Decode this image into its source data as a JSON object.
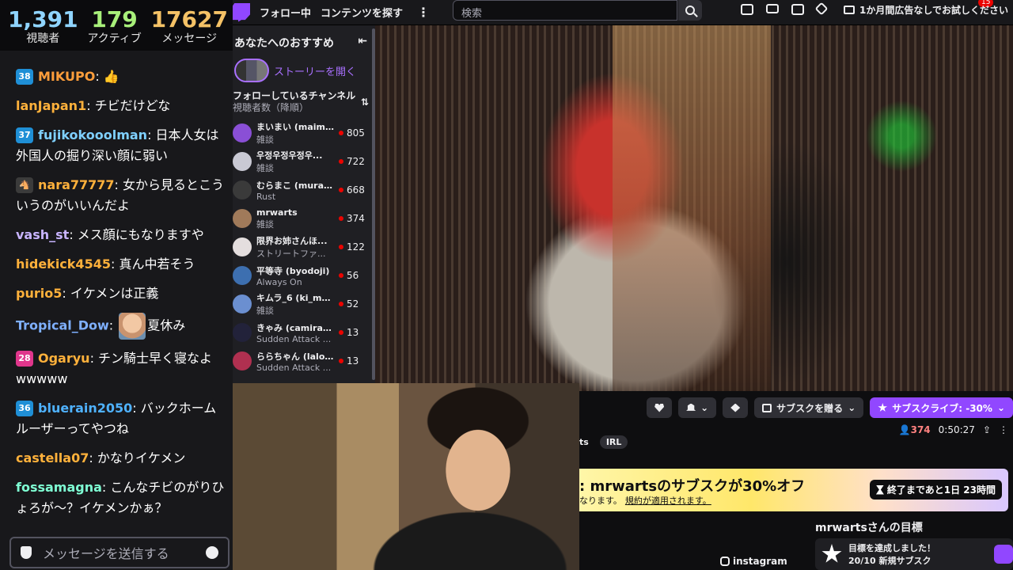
{
  "stats": [
    {
      "value": "1,391",
      "label": "視聴者",
      "color": "#8fd4ff"
    },
    {
      "value": "179",
      "label": "アクティブ",
      "color": "#a8f07a"
    },
    {
      "value": "17627",
      "label": "メッセージ",
      "color": "#f5c266"
    }
  ],
  "chat": [
    {
      "badge": "38",
      "badge_color": "#1f8fd6",
      "user": "MIKUPO",
      "color": "#ff9e3b",
      "text": ": 👍"
    },
    {
      "badge": "",
      "badge_color": "",
      "user": "lanJapan1",
      "color": "#ffb13b",
      "text": ": チビだけどな"
    },
    {
      "badge": "37",
      "badge_color": "#1f8fd6",
      "user": "fujikokooolman",
      "color": "#7fd0ff",
      "text": ": 日本人女は外国人の掘り深い顔に弱い"
    },
    {
      "badge": "🐴",
      "badge_color": "#3b3b3b",
      "user": "nara77777",
      "color": "#ffb13b",
      "text": ": 女から見るとこういうのがいいんだよ"
    },
    {
      "badge": "",
      "badge_color": "",
      "user": "vash_st",
      "color": "#c8b4ff",
      "text": ": メス顔にもなりますや"
    },
    {
      "badge": "",
      "badge_color": "",
      "user": "hidekick4545",
      "color": "#ffb13b",
      "text": ": 真ん中若そう"
    },
    {
      "badge": "",
      "badge_color": "",
      "user": "purio5",
      "color": "#ffb13b",
      "text": ": イケメンは正義"
    },
    {
      "badge": "",
      "badge_color": "",
      "user": "Tropical_Dow",
      "color": "#7fb0ff",
      "text": ": ",
      "emote": true,
      "text2": "夏休み"
    },
    {
      "badge": "28",
      "badge_color": "#e0368c",
      "user": "Ogaryu",
      "color": "#ffb13b",
      "text": ": チン騎士早く寝なよwwwww"
    },
    {
      "badge": "36",
      "badge_color": "#1f8fd6",
      "user": "bluerain2050",
      "color": "#4fb2ff",
      "text": ": バックホームルーザーってやつね"
    },
    {
      "badge": "",
      "badge_color": "",
      "user": "castella07",
      "color": "#ffb13b",
      "text": ": かなりイケメン"
    },
    {
      "badge": "",
      "badge_color": "",
      "user": "fossamagna",
      "color": "#7fffd4",
      "text": ": こんなチビのがりひょろが〜？イケメンかぁ？"
    }
  ],
  "chat_input": {
    "placeholder": "メッセージを送信する"
  },
  "topnav": {
    "following": "フォロー中",
    "browse": "コンテンツを探す",
    "more": "⋮",
    "search_placeholder": "検索",
    "notifications": "15",
    "trial": "1か月間広告なしでお試しください"
  },
  "sidenav": {
    "title": "あなたへのおすすめ",
    "collapse": "⇤",
    "story": "ストーリーを開く",
    "followed_title": "フォローしているチャンネル",
    "followed_sort": "視聴者数（降順）",
    "sort_icon": "⇅",
    "channels": [
      {
        "name": "まいまい (maima...",
        "category": "雑談",
        "viewers": "805",
        "color": "#8a4fd6"
      },
      {
        "name": "우정우정우정우...",
        "category": "雑談",
        "viewers": "722",
        "color": "#c9c9d4"
      },
      {
        "name": "むらまこ (murak...",
        "category": "Rust",
        "viewers": "668",
        "color": "#3a3a3a"
      },
      {
        "name": "mrwarts",
        "category": "雑談",
        "viewers": "374",
        "color": "#a07a5a"
      },
      {
        "name": "限界お姉さんほ...",
        "category": "ストリートファ...",
        "viewers": "122",
        "color": "#e4dede"
      },
      {
        "name": "平等寺 (byodoji)",
        "category": "Always On",
        "viewers": "56",
        "color": "#3d6fb0"
      },
      {
        "name": "キムラ_6 (ki_mu...",
        "category": "雑談",
        "viewers": "52",
        "color": "#6b8fd0"
      },
      {
        "name": "きゃみ (camirajit...",
        "category": "Sudden Attack ...",
        "viewers": "13",
        "color": "#22223a"
      },
      {
        "name": "ららちゃん (lalo...",
        "category": "Sudden Attack ...",
        "viewers": "13",
        "color": "#b03050"
      }
    ]
  },
  "actions": {
    "follow": "",
    "bell": "",
    "gift_label": "サブスクを贈る",
    "sub_label": "サブスクライブ: -30%"
  },
  "tags": [
    "ts",
    "IRL"
  ],
  "meta": {
    "viewers": "374",
    "uptime": "0:50:27"
  },
  "promo": {
    "title": ": mrwartsのサブスクが30%オフ",
    "note": "なります。",
    "terms": "規約が適用されます。",
    "timer": "終了まであと1日 23時間"
  },
  "goal": {
    "title": "mrwartsさんの目標",
    "achieved": "目標を達成しました！",
    "progress": "20/10 新規サブスク"
  },
  "social": {
    "instagram": "instagram"
  }
}
